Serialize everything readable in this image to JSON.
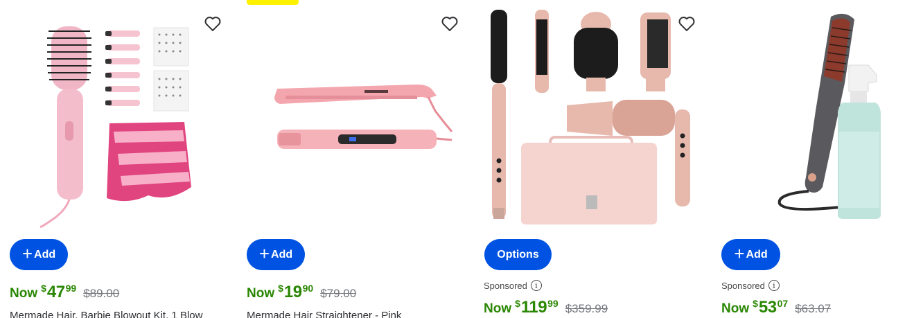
{
  "colors": {
    "primary": "#0053e2",
    "price_green": "#2a8703",
    "badge_yellow": "#fff200"
  },
  "products": [
    {
      "image_name": "barbie-blowout-kit-image",
      "button_label": "Add",
      "button_icon": "plus-icon",
      "sponsored": "",
      "now_label": "Now",
      "currency": "$",
      "dollars": "47",
      "cents": "99",
      "was_price": "$89.00",
      "title": "Mermade Hair, Barbie Blowout Kit, 1 Blow"
    },
    {
      "image_name": "hair-straightener-image",
      "button_label": "Add",
      "button_icon": "plus-icon",
      "sponsored": "",
      "now_label": "Now",
      "currency": "$",
      "dollars": "19",
      "cents": "90",
      "was_price": "$79.00",
      "title": "Mermade Hair Straightener - Pink"
    },
    {
      "image_name": "multi-styler-set-image",
      "button_label": "Options",
      "sponsored": "Sponsored",
      "now_label": "Now",
      "currency": "$",
      "dollars": "119",
      "cents": "99",
      "was_price": "$359.99",
      "title": ""
    },
    {
      "image_name": "straightening-brush-image",
      "button_label": "Add",
      "button_icon": "plus-icon",
      "sponsored": "Sponsored",
      "now_label": "Now",
      "currency": "$",
      "dollars": "53",
      "cents": "07",
      "was_price": "$63.07",
      "title": ""
    }
  ]
}
